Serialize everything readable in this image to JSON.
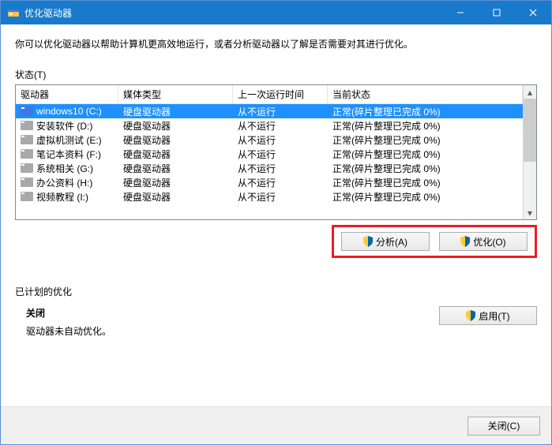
{
  "titlebar": {
    "title": "优化驱动器"
  },
  "description": "你可以优化驱动器以帮助计算机更高效地运行，或者分析驱动器以了解是否需要对其进行优化。",
  "status_label": "状态(T)",
  "columns": {
    "drive": "驱动器",
    "media": "媒体类型",
    "last": "上一次运行时间",
    "state": "当前状态"
  },
  "drives": [
    {
      "name": "windows10 (C:)",
      "media": "硬盘驱动器",
      "last": "从不运行",
      "state": "正常(碎片整理已完成 0%)",
      "selected": true,
      "win": true
    },
    {
      "name": "安装软件 (D:)",
      "media": "硬盘驱动器",
      "last": "从不运行",
      "state": "正常(碎片整理已完成 0%)"
    },
    {
      "name": "虚拟机测试 (E:)",
      "media": "硬盘驱动器",
      "last": "从不运行",
      "state": "正常(碎片整理已完成 0%)"
    },
    {
      "name": "笔记本资料 (F:)",
      "media": "硬盘驱动器",
      "last": "从不运行",
      "state": "正常(碎片整理已完成 0%)"
    },
    {
      "name": "系统相关 (G:)",
      "media": "硬盘驱动器",
      "last": "从不运行",
      "state": "正常(碎片整理已完成 0%)"
    },
    {
      "name": "办公资料 (H:)",
      "media": "硬盘驱动器",
      "last": "从不运行",
      "state": "正常(碎片整理已完成 0%)"
    },
    {
      "name": "视频教程 (I:)",
      "media": "硬盘驱动器",
      "last": "从不运行",
      "state": "正常(碎片整理已完成 0%)"
    }
  ],
  "buttons": {
    "analyze": "分析(A)",
    "optimize": "优化(O)",
    "enable": "启用(T)",
    "close": "关闭(C)"
  },
  "scheduled": {
    "heading": "已计划的优化",
    "off": "关闭",
    "note": "驱动器未自动优化。"
  }
}
